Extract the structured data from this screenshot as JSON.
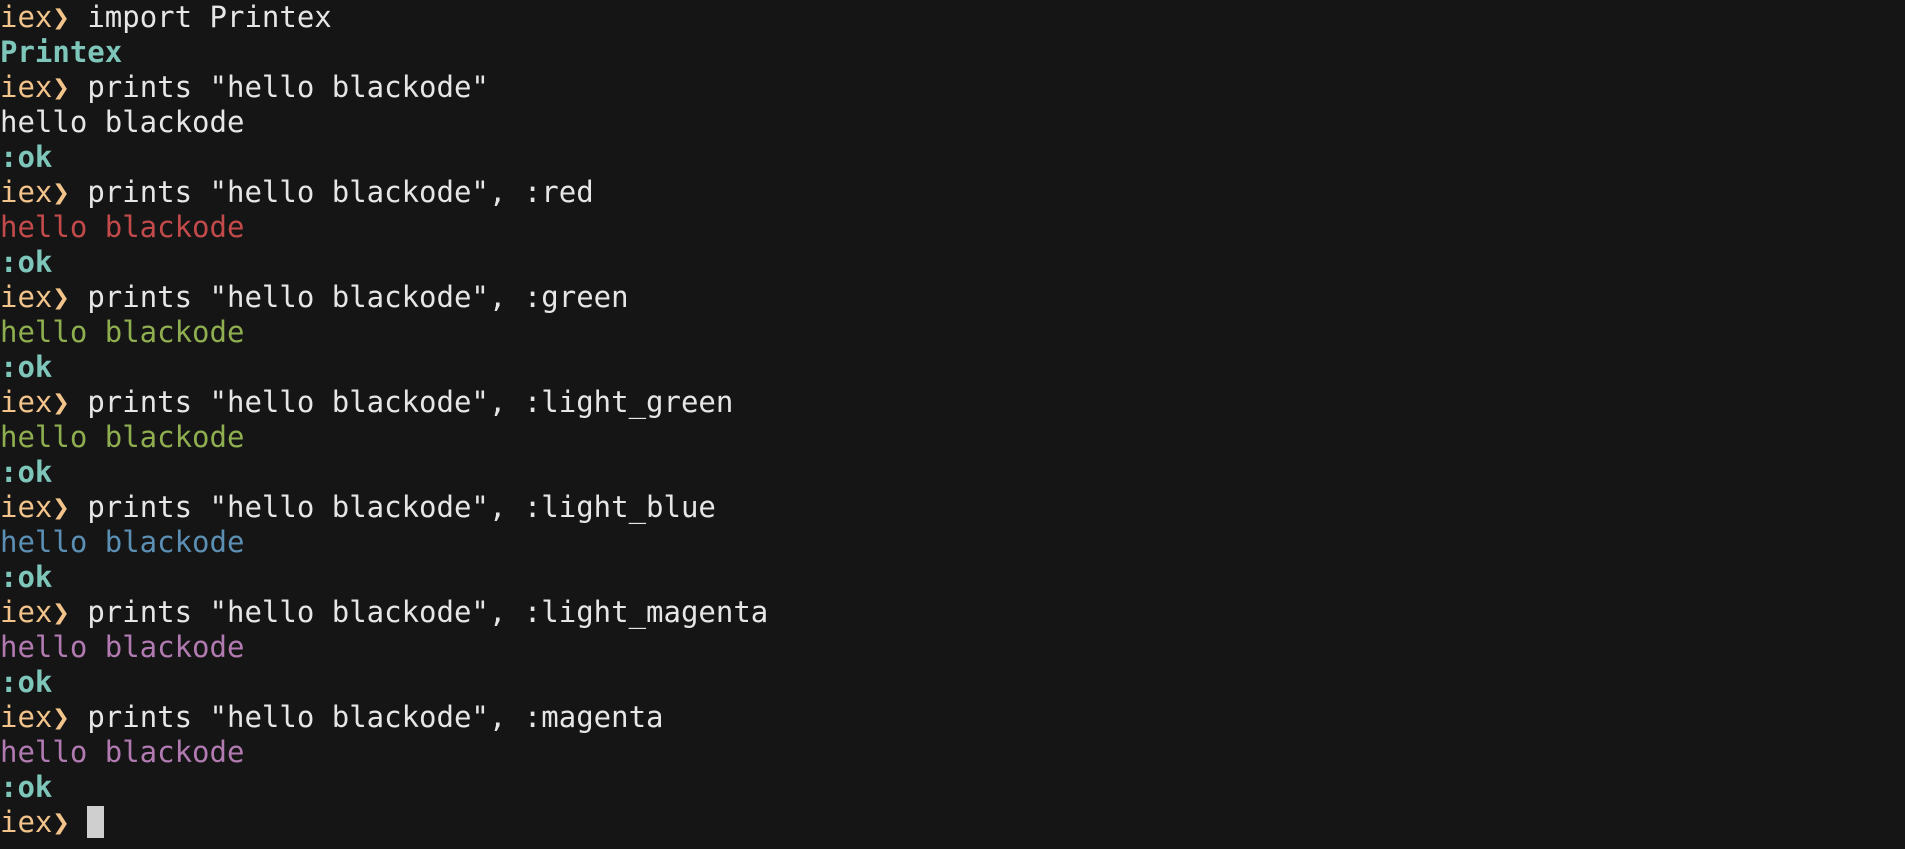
{
  "terminal": {
    "prompt": "iex",
    "arrow": "❯",
    "colors": {
      "background": "#151515",
      "prompt": "#f2c38a",
      "command": "#e6e6e6",
      "atom": "#7fc6ba",
      "red": "#c24a4a",
      "green": "#8fae4f",
      "light_green": "#8fae4f",
      "light_blue": "#5b8fb3",
      "light_magenta": "#b17ab1",
      "magenta": "#b17ab1"
    },
    "lines": [
      {
        "kind": "input",
        "text": "import Printex"
      },
      {
        "kind": "module",
        "text": "Printex"
      },
      {
        "kind": "input",
        "text": "prints \"hello blackode\""
      },
      {
        "kind": "output",
        "text": "hello blackode",
        "color": "#e6e6e6"
      },
      {
        "kind": "atom",
        "text": ":ok"
      },
      {
        "kind": "input",
        "text": "prints \"hello blackode\", :red"
      },
      {
        "kind": "output",
        "text": "hello blackode",
        "color": "#c24a4a"
      },
      {
        "kind": "atom",
        "text": ":ok"
      },
      {
        "kind": "input",
        "text": "prints \"hello blackode\", :green"
      },
      {
        "kind": "output",
        "text": "hello blackode",
        "color": "#8fae4f"
      },
      {
        "kind": "atom",
        "text": ":ok"
      },
      {
        "kind": "input",
        "text": "prints \"hello blackode\", :light_green"
      },
      {
        "kind": "output",
        "text": "hello blackode",
        "color": "#8fae4f"
      },
      {
        "kind": "atom",
        "text": ":ok"
      },
      {
        "kind": "input",
        "text": "prints \"hello blackode\", :light_blue"
      },
      {
        "kind": "output",
        "text": "hello blackode",
        "color": "#5b8fb3"
      },
      {
        "kind": "atom",
        "text": ":ok"
      },
      {
        "kind": "input",
        "text": "prints \"hello blackode\", :light_magenta"
      },
      {
        "kind": "output",
        "text": "hello blackode",
        "color": "#b17ab1"
      },
      {
        "kind": "atom",
        "text": ":ok"
      },
      {
        "kind": "input",
        "text": "prints \"hello blackode\", :magenta"
      },
      {
        "kind": "output",
        "text": "hello blackode",
        "color": "#b17ab1"
      },
      {
        "kind": "atom",
        "text": ":ok"
      },
      {
        "kind": "current-input",
        "text": ""
      }
    ]
  }
}
